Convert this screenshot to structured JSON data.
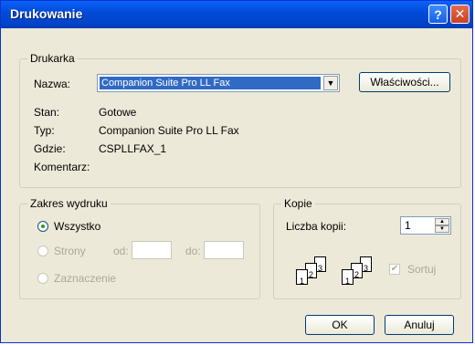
{
  "window": {
    "title": "Drukowanie"
  },
  "printer": {
    "group_label": "Drukarka",
    "name_label": "Nazwa:",
    "name_value": "Companion Suite Pro LL Fax",
    "properties_button": "Właściwości...",
    "status_label": "Stan:",
    "status_value": "Gotowe",
    "type_label": "Typ:",
    "type_value": "Companion Suite Pro LL Fax",
    "where_label": "Gdzie:",
    "where_value": "CSPLLFAX_1",
    "comment_label": "Komentarz:"
  },
  "range": {
    "group_label": "Zakres wydruku",
    "all_label": "Wszystko",
    "pages_label": "Strony",
    "from_label": "od:",
    "to_label": "do:",
    "selection_label": "Zaznaczenie",
    "selected": "all"
  },
  "copies": {
    "group_label": "Kopie",
    "count_label": "Liczba kopii:",
    "count_value": "1",
    "collate_label": "Sortuj",
    "collate_checked": true,
    "collate_icon_pages": [
      "1",
      "2",
      "3"
    ]
  },
  "buttons": {
    "ok": "OK",
    "cancel": "Anuluj"
  },
  "icons": {
    "help": "help-icon",
    "close": "close-icon",
    "dropdown": "chevron-down-icon",
    "spinner_up": "arrow-up-icon",
    "spinner_down": "arrow-down-icon"
  }
}
